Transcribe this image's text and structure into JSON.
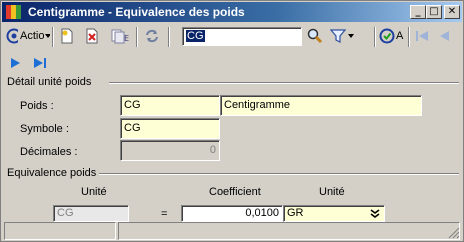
{
  "window": {
    "title": "Centigramme - Equivalence des poids",
    "colors": {
      "title_start": "#0a246a",
      "title_end": "#a6caf0",
      "field_bg": "#ffffd5"
    }
  },
  "toolbar": {
    "actions_label": "Actio",
    "search_value": "CG",
    "filter_label": "A"
  },
  "detail": {
    "group_title": "Détail unité poids",
    "poids_label": "Poids :",
    "poids_code": "CG",
    "poids_name": "Centigramme",
    "symbole_label": "Symbole :",
    "symbole_value": "CG",
    "decimales_label": "Décimales :",
    "decimales_value": "0"
  },
  "equivalence": {
    "group_title": "Equivalence poids",
    "columns": [
      "Unité",
      "Coefficient",
      "Unité"
    ],
    "row": {
      "from_unit": "CG",
      "equals": "=",
      "coefficient": "0,0100",
      "to_unit": "GR"
    }
  }
}
